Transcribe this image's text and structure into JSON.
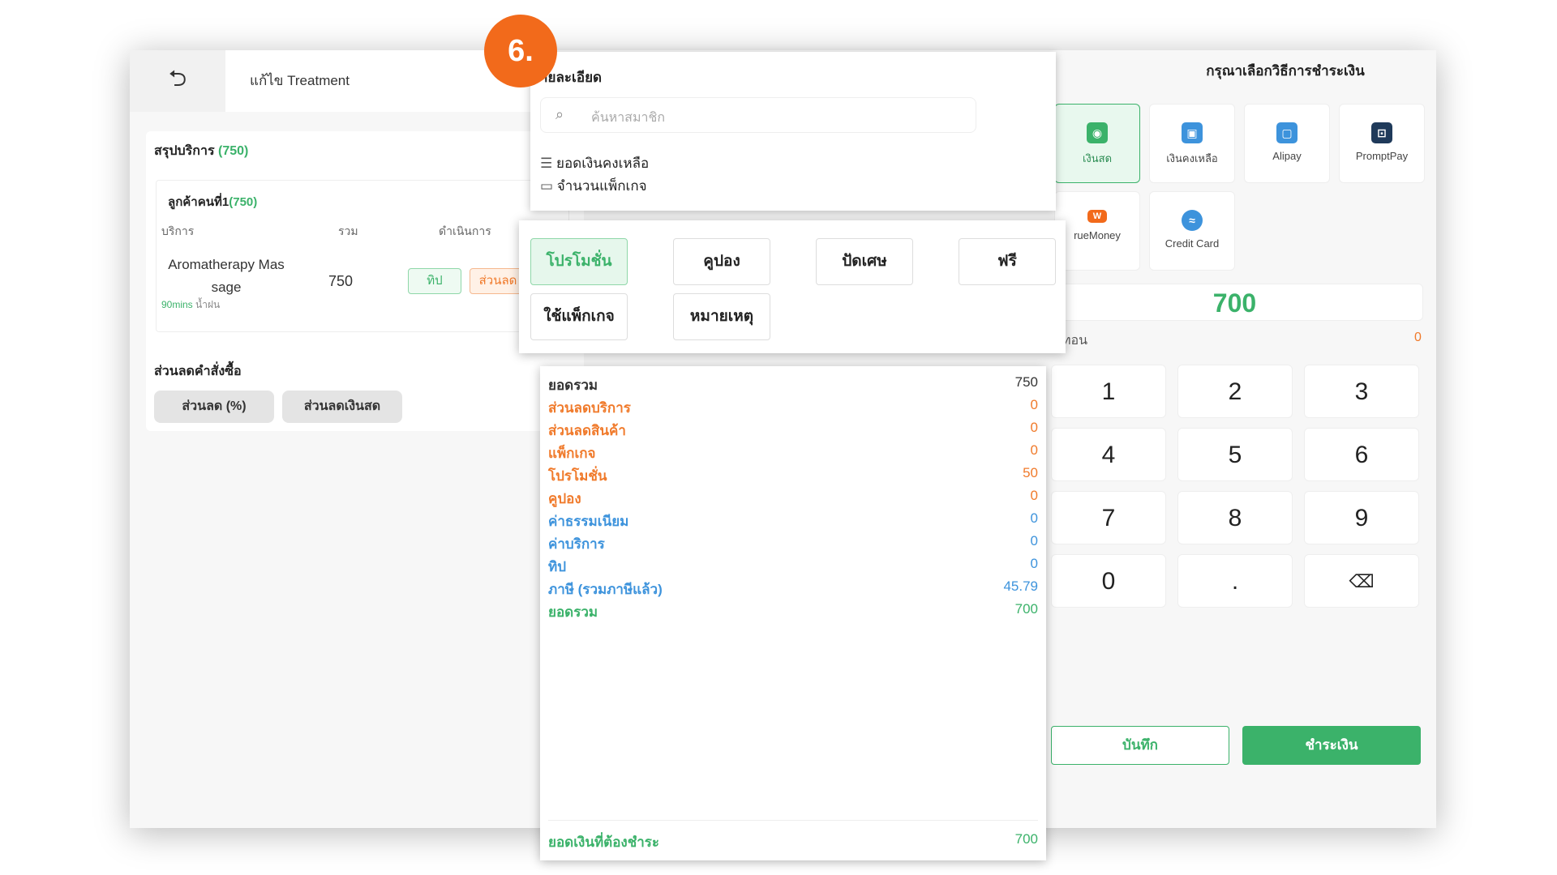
{
  "step_badge": "6.",
  "left": {
    "title": "แก้ไข Treatment",
    "summary_label": "สรุปบริการ",
    "summary_total": "(750)",
    "customer_label": "ลูกค้าคนที่1",
    "customer_total": "(750)",
    "columns": [
      "บริการ",
      "รวม",
      "ดำเนินการ"
    ],
    "service_name_line1": "Aromatherapy Mas",
    "service_name_line2": "sage",
    "service_duration": "90mins",
    "service_staff": "น้ำฝน",
    "service_total": "750",
    "tip_label": "ทิป",
    "discount_label": "ส่วนลด",
    "order_discount_label": "ส่วนลดคำสั่งซื้อ",
    "discount_percent_label": "ส่วนลด (%)",
    "discount_cash_label": "ส่วนลดเงินสด"
  },
  "detail": {
    "title": "ายละเอียด",
    "search_placeholder": "ค้นหาสมาชิก",
    "balance_label": "ยอดเงินคงเหลือ",
    "package_label": "จำนวนแพ็กเกจ"
  },
  "promo_buttons": [
    "โปรโมชั่น",
    "คูปอง",
    "ปัดเศษ",
    "ฟรี",
    "ใช้แพ็กเกจ",
    "หมายเหตุ"
  ],
  "summary": {
    "rows": [
      {
        "label": "ยอดรวม",
        "value": "750",
        "style": "dark"
      },
      {
        "label": "ส่วนลดบริการ",
        "value": "0",
        "style": "orange"
      },
      {
        "label": "ส่วนลดสินค้า",
        "value": "0",
        "style": "orange"
      },
      {
        "label": "แพ็กเกจ",
        "value": "0",
        "style": "orange"
      },
      {
        "label": "โปรโมชั่น",
        "value": "50",
        "style": "orange"
      },
      {
        "label": "คูปอง",
        "value": "0",
        "style": "orange"
      },
      {
        "label": "ค่าธรรมเนียม",
        "value": "0",
        "style": "blue"
      },
      {
        "label": "ค่าบริการ",
        "value": "0",
        "style": "blue"
      },
      {
        "label": "ทิป",
        "value": "0",
        "style": "blue"
      },
      {
        "label": "ภาษี (รวมภาษีแล้ว)",
        "value": "45.79",
        "style": "blue"
      },
      {
        "label": "ยอดรวม",
        "value": "700",
        "style": "greenrow"
      }
    ],
    "due_label": "ยอดเงินที่ต้องชำระ",
    "due_value": "700"
  },
  "payment": {
    "title": "กรุณาเลือกวิธีการชำระเงิน",
    "methods": [
      {
        "label": "เงินสด",
        "icon": "cash-icon",
        "color": "#3bb26a"
      },
      {
        "label": "เงินคงเหลือ",
        "icon": "wallet-icon",
        "color": "#3d93dc"
      },
      {
        "label": "Alipay",
        "icon": "alipay-icon",
        "color": "#3d93dc"
      },
      {
        "label": "PromptPay",
        "icon": "promptpay-icon",
        "color": "#1f3a5a"
      },
      {
        "label": "rueMoney",
        "icon": "truemoney-icon",
        "color": "#f26a1b"
      },
      {
        "label": "Credit Card",
        "icon": "credit-card-icon",
        "color": "#3d93dc"
      }
    ],
    "amount": "700",
    "change_label": "ทอน",
    "change_value": "0",
    "keys": [
      "1",
      "2",
      "3",
      "4",
      "5",
      "6",
      "7",
      "8",
      "9",
      "0",
      ".",
      "⌫"
    ],
    "save_label": "บันทึก",
    "pay_label": "ชำระเงิน"
  }
}
